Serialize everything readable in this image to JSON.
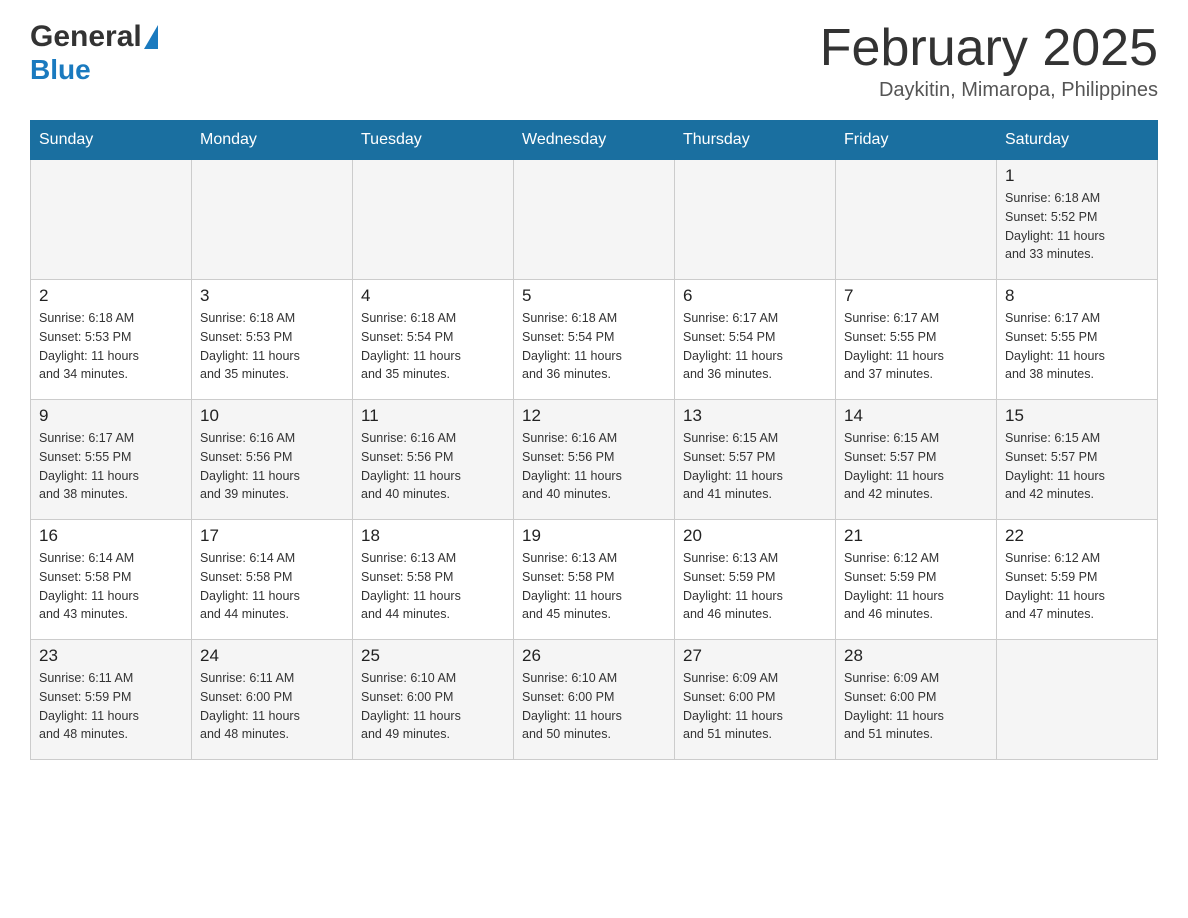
{
  "header": {
    "logo_general": "General",
    "logo_blue": "Blue",
    "month_title": "February 2025",
    "location": "Daykitin, Mimaropa, Philippines"
  },
  "days_of_week": [
    "Sunday",
    "Monday",
    "Tuesday",
    "Wednesday",
    "Thursday",
    "Friday",
    "Saturday"
  ],
  "weeks": [
    {
      "cells": [
        {
          "day": "",
          "info": ""
        },
        {
          "day": "",
          "info": ""
        },
        {
          "day": "",
          "info": ""
        },
        {
          "day": "",
          "info": ""
        },
        {
          "day": "",
          "info": ""
        },
        {
          "day": "",
          "info": ""
        },
        {
          "day": "1",
          "info": "Sunrise: 6:18 AM\nSunset: 5:52 PM\nDaylight: 11 hours\nand 33 minutes."
        }
      ]
    },
    {
      "cells": [
        {
          "day": "2",
          "info": "Sunrise: 6:18 AM\nSunset: 5:53 PM\nDaylight: 11 hours\nand 34 minutes."
        },
        {
          "day": "3",
          "info": "Sunrise: 6:18 AM\nSunset: 5:53 PM\nDaylight: 11 hours\nand 35 minutes."
        },
        {
          "day": "4",
          "info": "Sunrise: 6:18 AM\nSunset: 5:54 PM\nDaylight: 11 hours\nand 35 minutes."
        },
        {
          "day": "5",
          "info": "Sunrise: 6:18 AM\nSunset: 5:54 PM\nDaylight: 11 hours\nand 36 minutes."
        },
        {
          "day": "6",
          "info": "Sunrise: 6:17 AM\nSunset: 5:54 PM\nDaylight: 11 hours\nand 36 minutes."
        },
        {
          "day": "7",
          "info": "Sunrise: 6:17 AM\nSunset: 5:55 PM\nDaylight: 11 hours\nand 37 minutes."
        },
        {
          "day": "8",
          "info": "Sunrise: 6:17 AM\nSunset: 5:55 PM\nDaylight: 11 hours\nand 38 minutes."
        }
      ]
    },
    {
      "cells": [
        {
          "day": "9",
          "info": "Sunrise: 6:17 AM\nSunset: 5:55 PM\nDaylight: 11 hours\nand 38 minutes."
        },
        {
          "day": "10",
          "info": "Sunrise: 6:16 AM\nSunset: 5:56 PM\nDaylight: 11 hours\nand 39 minutes."
        },
        {
          "day": "11",
          "info": "Sunrise: 6:16 AM\nSunset: 5:56 PM\nDaylight: 11 hours\nand 40 minutes."
        },
        {
          "day": "12",
          "info": "Sunrise: 6:16 AM\nSunset: 5:56 PM\nDaylight: 11 hours\nand 40 minutes."
        },
        {
          "day": "13",
          "info": "Sunrise: 6:15 AM\nSunset: 5:57 PM\nDaylight: 11 hours\nand 41 minutes."
        },
        {
          "day": "14",
          "info": "Sunrise: 6:15 AM\nSunset: 5:57 PM\nDaylight: 11 hours\nand 42 minutes."
        },
        {
          "day": "15",
          "info": "Sunrise: 6:15 AM\nSunset: 5:57 PM\nDaylight: 11 hours\nand 42 minutes."
        }
      ]
    },
    {
      "cells": [
        {
          "day": "16",
          "info": "Sunrise: 6:14 AM\nSunset: 5:58 PM\nDaylight: 11 hours\nand 43 minutes."
        },
        {
          "day": "17",
          "info": "Sunrise: 6:14 AM\nSunset: 5:58 PM\nDaylight: 11 hours\nand 44 minutes."
        },
        {
          "day": "18",
          "info": "Sunrise: 6:13 AM\nSunset: 5:58 PM\nDaylight: 11 hours\nand 44 minutes."
        },
        {
          "day": "19",
          "info": "Sunrise: 6:13 AM\nSunset: 5:58 PM\nDaylight: 11 hours\nand 45 minutes."
        },
        {
          "day": "20",
          "info": "Sunrise: 6:13 AM\nSunset: 5:59 PM\nDaylight: 11 hours\nand 46 minutes."
        },
        {
          "day": "21",
          "info": "Sunrise: 6:12 AM\nSunset: 5:59 PM\nDaylight: 11 hours\nand 46 minutes."
        },
        {
          "day": "22",
          "info": "Sunrise: 6:12 AM\nSunset: 5:59 PM\nDaylight: 11 hours\nand 47 minutes."
        }
      ]
    },
    {
      "cells": [
        {
          "day": "23",
          "info": "Sunrise: 6:11 AM\nSunset: 5:59 PM\nDaylight: 11 hours\nand 48 minutes."
        },
        {
          "day": "24",
          "info": "Sunrise: 6:11 AM\nSunset: 6:00 PM\nDaylight: 11 hours\nand 48 minutes."
        },
        {
          "day": "25",
          "info": "Sunrise: 6:10 AM\nSunset: 6:00 PM\nDaylight: 11 hours\nand 49 minutes."
        },
        {
          "day": "26",
          "info": "Sunrise: 6:10 AM\nSunset: 6:00 PM\nDaylight: 11 hours\nand 50 minutes."
        },
        {
          "day": "27",
          "info": "Sunrise: 6:09 AM\nSunset: 6:00 PM\nDaylight: 11 hours\nand 51 minutes."
        },
        {
          "day": "28",
          "info": "Sunrise: 6:09 AM\nSunset: 6:00 PM\nDaylight: 11 hours\nand 51 minutes."
        },
        {
          "day": "",
          "info": ""
        }
      ]
    }
  ]
}
